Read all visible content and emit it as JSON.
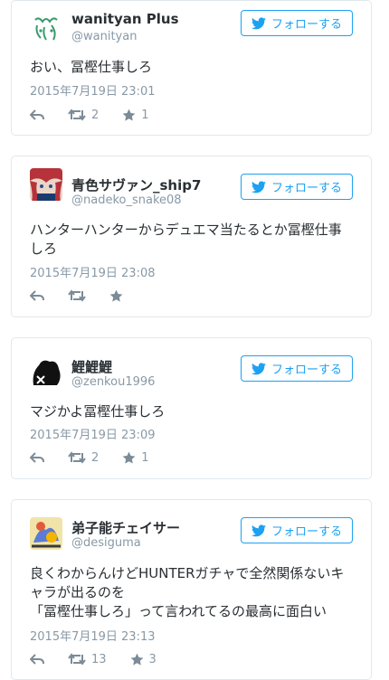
{
  "follow_label": "フォローする",
  "tweets": [
    {
      "name": "wanityan Plus",
      "handle": "@wanityan",
      "text": "おい、冨樫仕事しろ",
      "date": "2015年7月19日 23:01",
      "retweets": "2",
      "likes": "1",
      "avatar_color": "#3a9a6c"
    },
    {
      "name": "青色サヴァン_ship7",
      "handle": "@nadeko_snake08",
      "text": "ハンターハンターからデュエマ当たるとか冨樫仕事しろ",
      "date": "2015年7月19日 23:08",
      "retweets": "",
      "likes": "",
      "avatar_color": "#b7323a"
    },
    {
      "name": "鯉鯉鯉",
      "handle": "@zenkou1996",
      "text": "マジかよ冨樫仕事しろ",
      "date": "2015年7月19日 23:09",
      "retweets": "2",
      "likes": "1",
      "avatar_color": "#111111"
    },
    {
      "name": "弟子能チェイサー",
      "handle": "@desiguma",
      "text_lines": [
        "良くわからんけどHUNTERガチャで全然関係ないキャラが出るのを",
        "「冨樫仕事しろ」って言われてるの最高に面白い"
      ],
      "date": "2015年7月19日 23:13",
      "retweets": "13",
      "likes": "3",
      "avatar_color": "#5b7bd5"
    }
  ]
}
